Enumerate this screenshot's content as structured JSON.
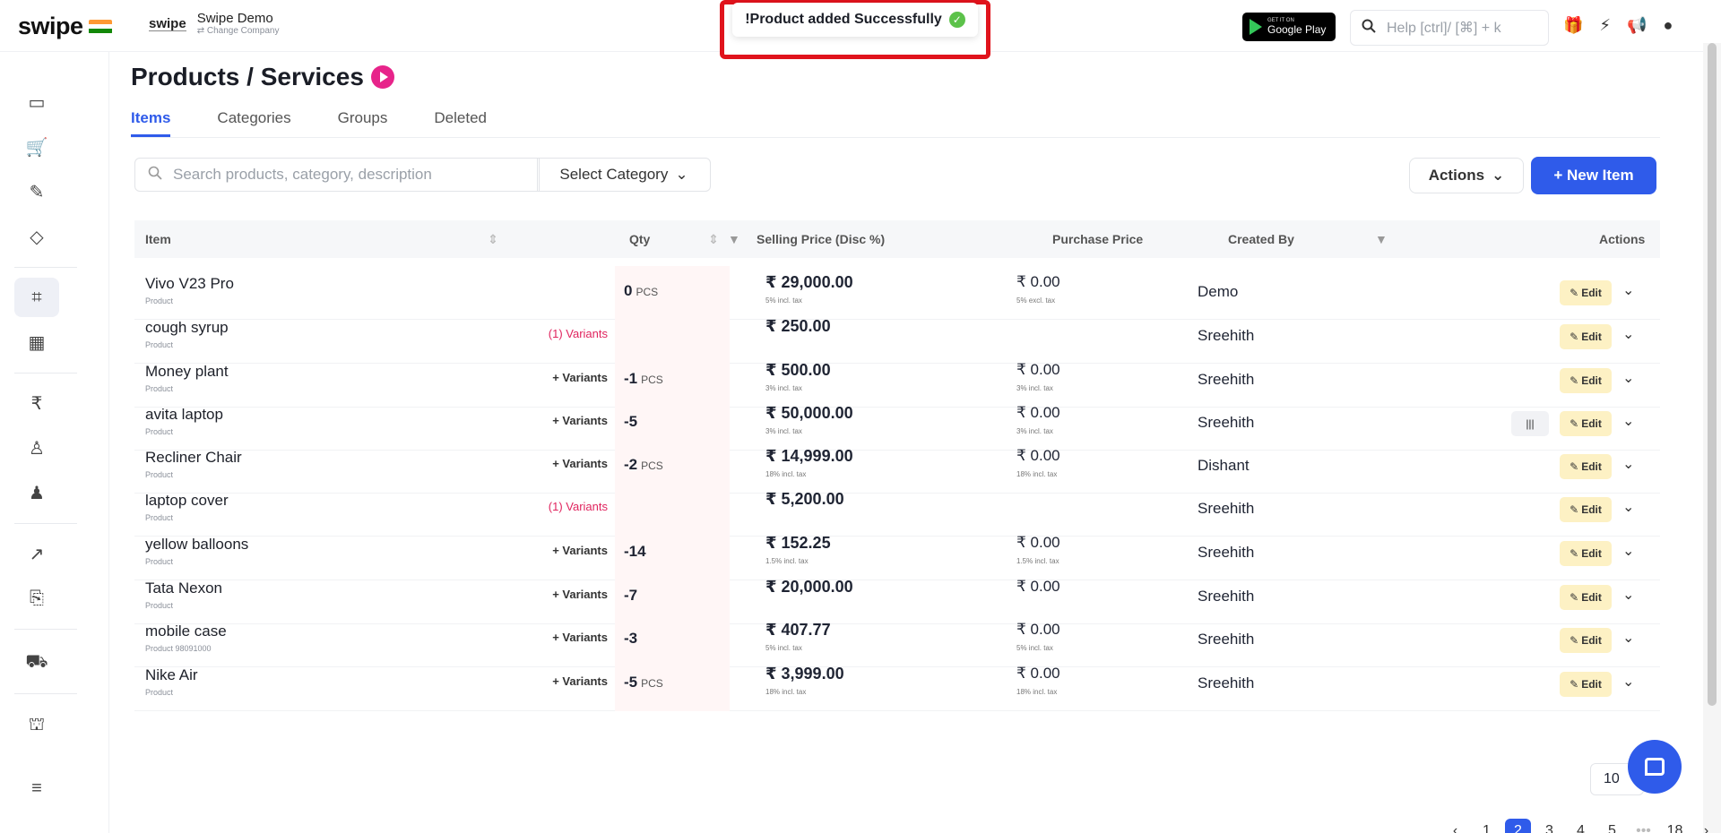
{
  "header": {
    "logo": "swipe",
    "company_logo": "swipe",
    "company_name": "Swipe Demo",
    "company_sub": "⇄ Change Company",
    "toast": "!Product added Successfully",
    "gplay_top": "GET IT ON",
    "gplay_bottom": "Google Play",
    "help_placeholder": "Help [ctrl]/ [⌘] + k",
    "icons": [
      "gift-icon",
      "bolt-icon",
      "megaphone-icon",
      "user-icon"
    ]
  },
  "sidebar": {
    "icons": [
      "cash-icon",
      "cart-icon",
      "pencil-icon",
      "tag-icon",
      "scan-icon",
      "warehouse-icon",
      "rupee-icon",
      "user-icon",
      "users-icon",
      "chart-icon",
      "report-icon",
      "truck-icon",
      "store-icon",
      "menu-icon"
    ]
  },
  "page": {
    "title": "Products / Services",
    "tabs": [
      "Items",
      "Categories",
      "Groups",
      "Deleted"
    ],
    "active_tab": "Items",
    "search_placeholder": "Search products, category, description",
    "select_category": "Select Category",
    "actions_label": "Actions",
    "new_item_label": "+ New Item"
  },
  "table": {
    "headers": {
      "item": "Item",
      "qty": "Qty",
      "selling": "Selling Price (Disc %)",
      "purchase": "Purchase Price",
      "created_by": "Created By",
      "actions": "Actions"
    },
    "edit_label": "Edit",
    "rows": [
      {
        "name": "Vivo V23 Pro",
        "sub": "Product",
        "variants": "",
        "qty": "0",
        "unit": "PCS",
        "sp": "₹ 29,000.00",
        "sp_tax": "5% incl. tax",
        "pp": "₹ 0.00",
        "pp_tax": "5% excl. tax",
        "by": "Demo"
      },
      {
        "name": "cough syrup",
        "sub": "Product",
        "variants": "(1) Variants",
        "qty": "",
        "unit": "",
        "sp": "₹ 250.00",
        "sp_tax": "",
        "pp": "",
        "pp_tax": "",
        "by": "Sreehith"
      },
      {
        "name": "Money plant",
        "sub": "Product",
        "variants": "+ Variants",
        "qty": "-1",
        "unit": "PCS",
        "sp": "₹ 500.00",
        "sp_tax": "3% incl. tax",
        "pp": "₹ 0.00",
        "pp_tax": "3% incl. tax",
        "by": "Sreehith"
      },
      {
        "name": "avita laptop",
        "sub": "Product",
        "variants": "+ Variants",
        "qty": "-5",
        "unit": "",
        "sp": "₹ 50,000.00",
        "sp_tax": "3% incl. tax",
        "pp": "₹ 0.00",
        "pp_tax": "3% incl. tax",
        "by": "Sreehith"
      },
      {
        "name": "Recliner Chair",
        "sub": "Product",
        "variants": "+ Variants",
        "qty": "-2",
        "unit": "PCS",
        "sp": "₹ 14,999.00",
        "sp_tax": "18% incl. tax",
        "pp": "₹ 0.00",
        "pp_tax": "18% incl. tax",
        "by": "Dishant"
      },
      {
        "name": "laptop cover",
        "sub": "Product",
        "variants": "(1) Variants",
        "qty": "",
        "unit": "",
        "sp": "₹ 5,200.00",
        "sp_tax": "",
        "pp": "",
        "pp_tax": "",
        "by": "Sreehith"
      },
      {
        "name": "yellow balloons",
        "sub": "Product",
        "variants": "+ Variants",
        "qty": "-14",
        "unit": "",
        "sp": "₹ 152.25",
        "sp_tax": "1.5% incl. tax",
        "pp": "₹ 0.00",
        "pp_tax": "1.5% incl. tax",
        "by": "Sreehith"
      },
      {
        "name": "Tata Nexon",
        "sub": "Product",
        "variants": "+ Variants",
        "qty": "-7",
        "unit": "",
        "sp": "₹ 20,000.00",
        "sp_tax": "",
        "pp": "₹ 0.00",
        "pp_tax": "",
        "by": "Sreehith"
      },
      {
        "name": "mobile case",
        "sub": "Product 98091000",
        "variants": "+ Variants",
        "qty": "-3",
        "unit": "",
        "sp": "₹ 407.77",
        "sp_tax": "5% incl. tax",
        "pp": "₹ 0.00",
        "pp_tax": "5% incl. tax",
        "by": "Sreehith"
      },
      {
        "name": "Nike Air",
        "sub": "Product",
        "variants": "+ Variants",
        "qty": "-5",
        "unit": "PCS",
        "sp": "₹ 3,999.00",
        "sp_tax": "18% incl. tax",
        "pp": "₹ 0.00",
        "pp_tax": "18% incl. tax",
        "by": "Sreehith"
      }
    ]
  },
  "pagination": {
    "pages": [
      "1",
      "2",
      "3",
      "4",
      "5",
      "•••",
      "18"
    ],
    "active": "2",
    "per_page": "10"
  }
}
